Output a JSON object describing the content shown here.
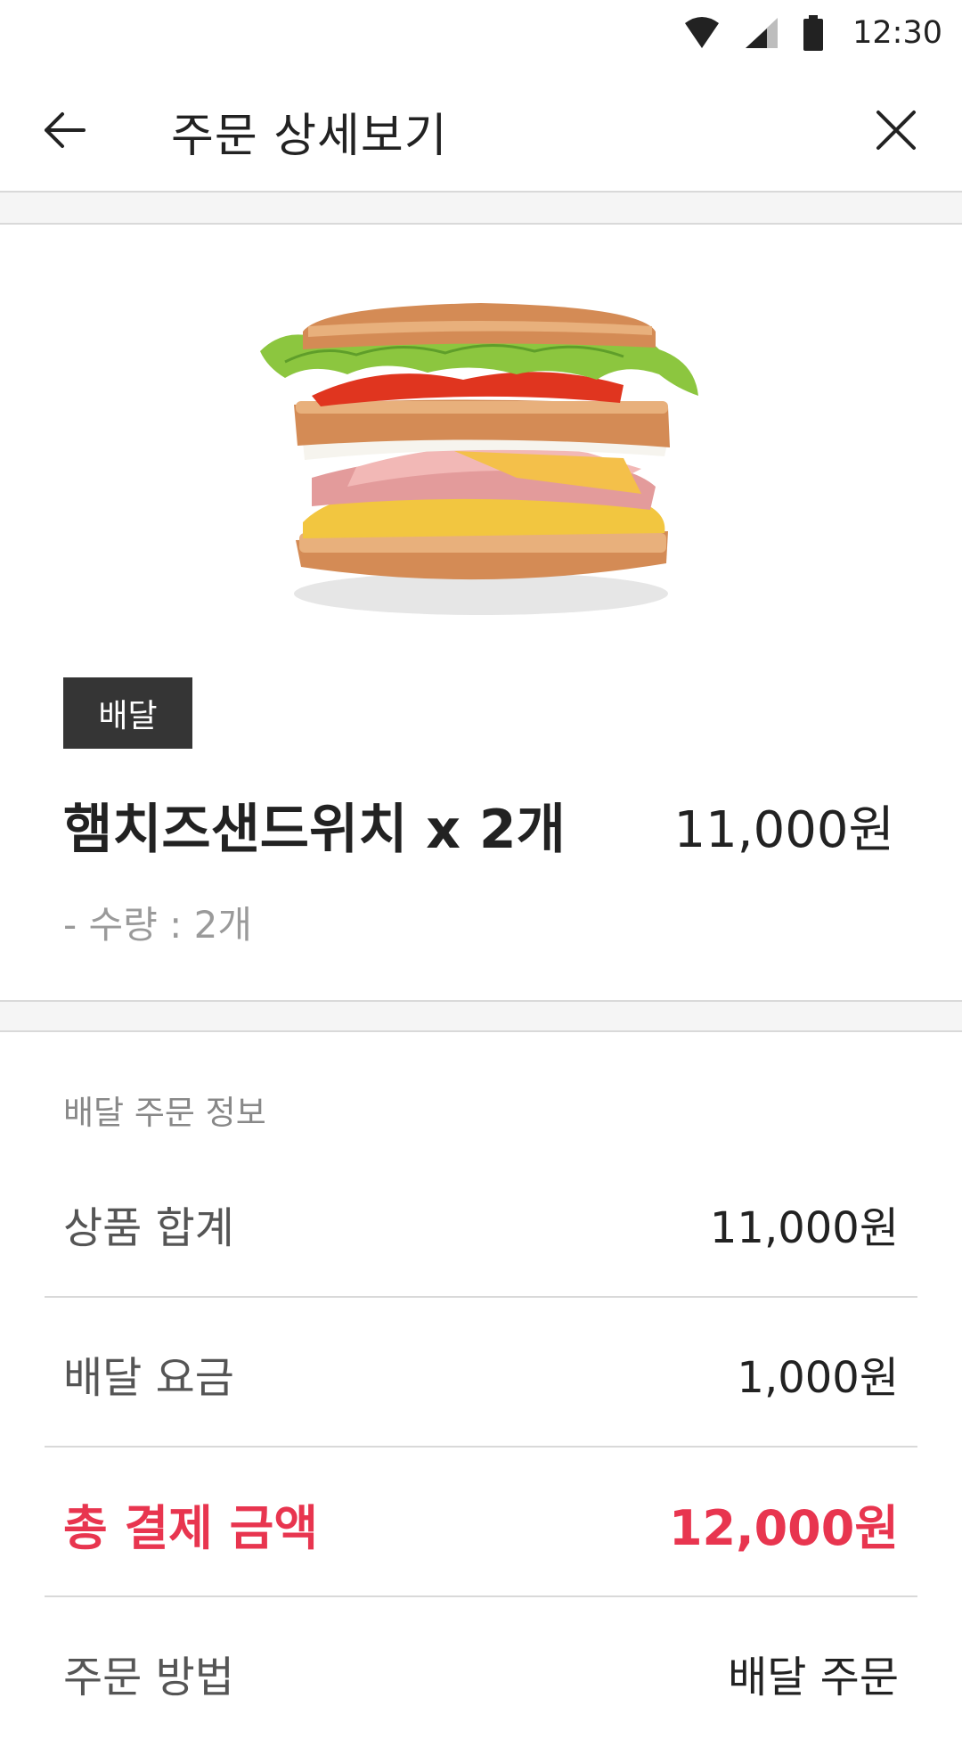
{
  "status_bar": {
    "time": "12:30",
    "icons": [
      "wifi-icon",
      "signal-icon",
      "battery-icon"
    ]
  },
  "app_bar": {
    "title": "주문 상세보기",
    "back_icon": "arrow-left-icon",
    "close_icon": "close-icon"
  },
  "product": {
    "image_alt": "sandwich-image",
    "badge": "배달",
    "name": "햄치즈샌드위치 x 2개",
    "price": "11,000원",
    "quantity": "- 수량 : 2개"
  },
  "order_info": {
    "section_title": "배달 주문 정보",
    "rows": [
      {
        "label": "상품 합계",
        "value": "11,000원"
      },
      {
        "label": "배달 요금",
        "value": "1,000원"
      },
      {
        "label": "총 결제 금액",
        "value": "12,000원"
      },
      {
        "label": "주문 방법",
        "value": "배달 주문"
      }
    ]
  },
  "colors": {
    "accent": "#e8354f",
    "badge_bg": "#353535",
    "divider": "#d9d9d9"
  }
}
